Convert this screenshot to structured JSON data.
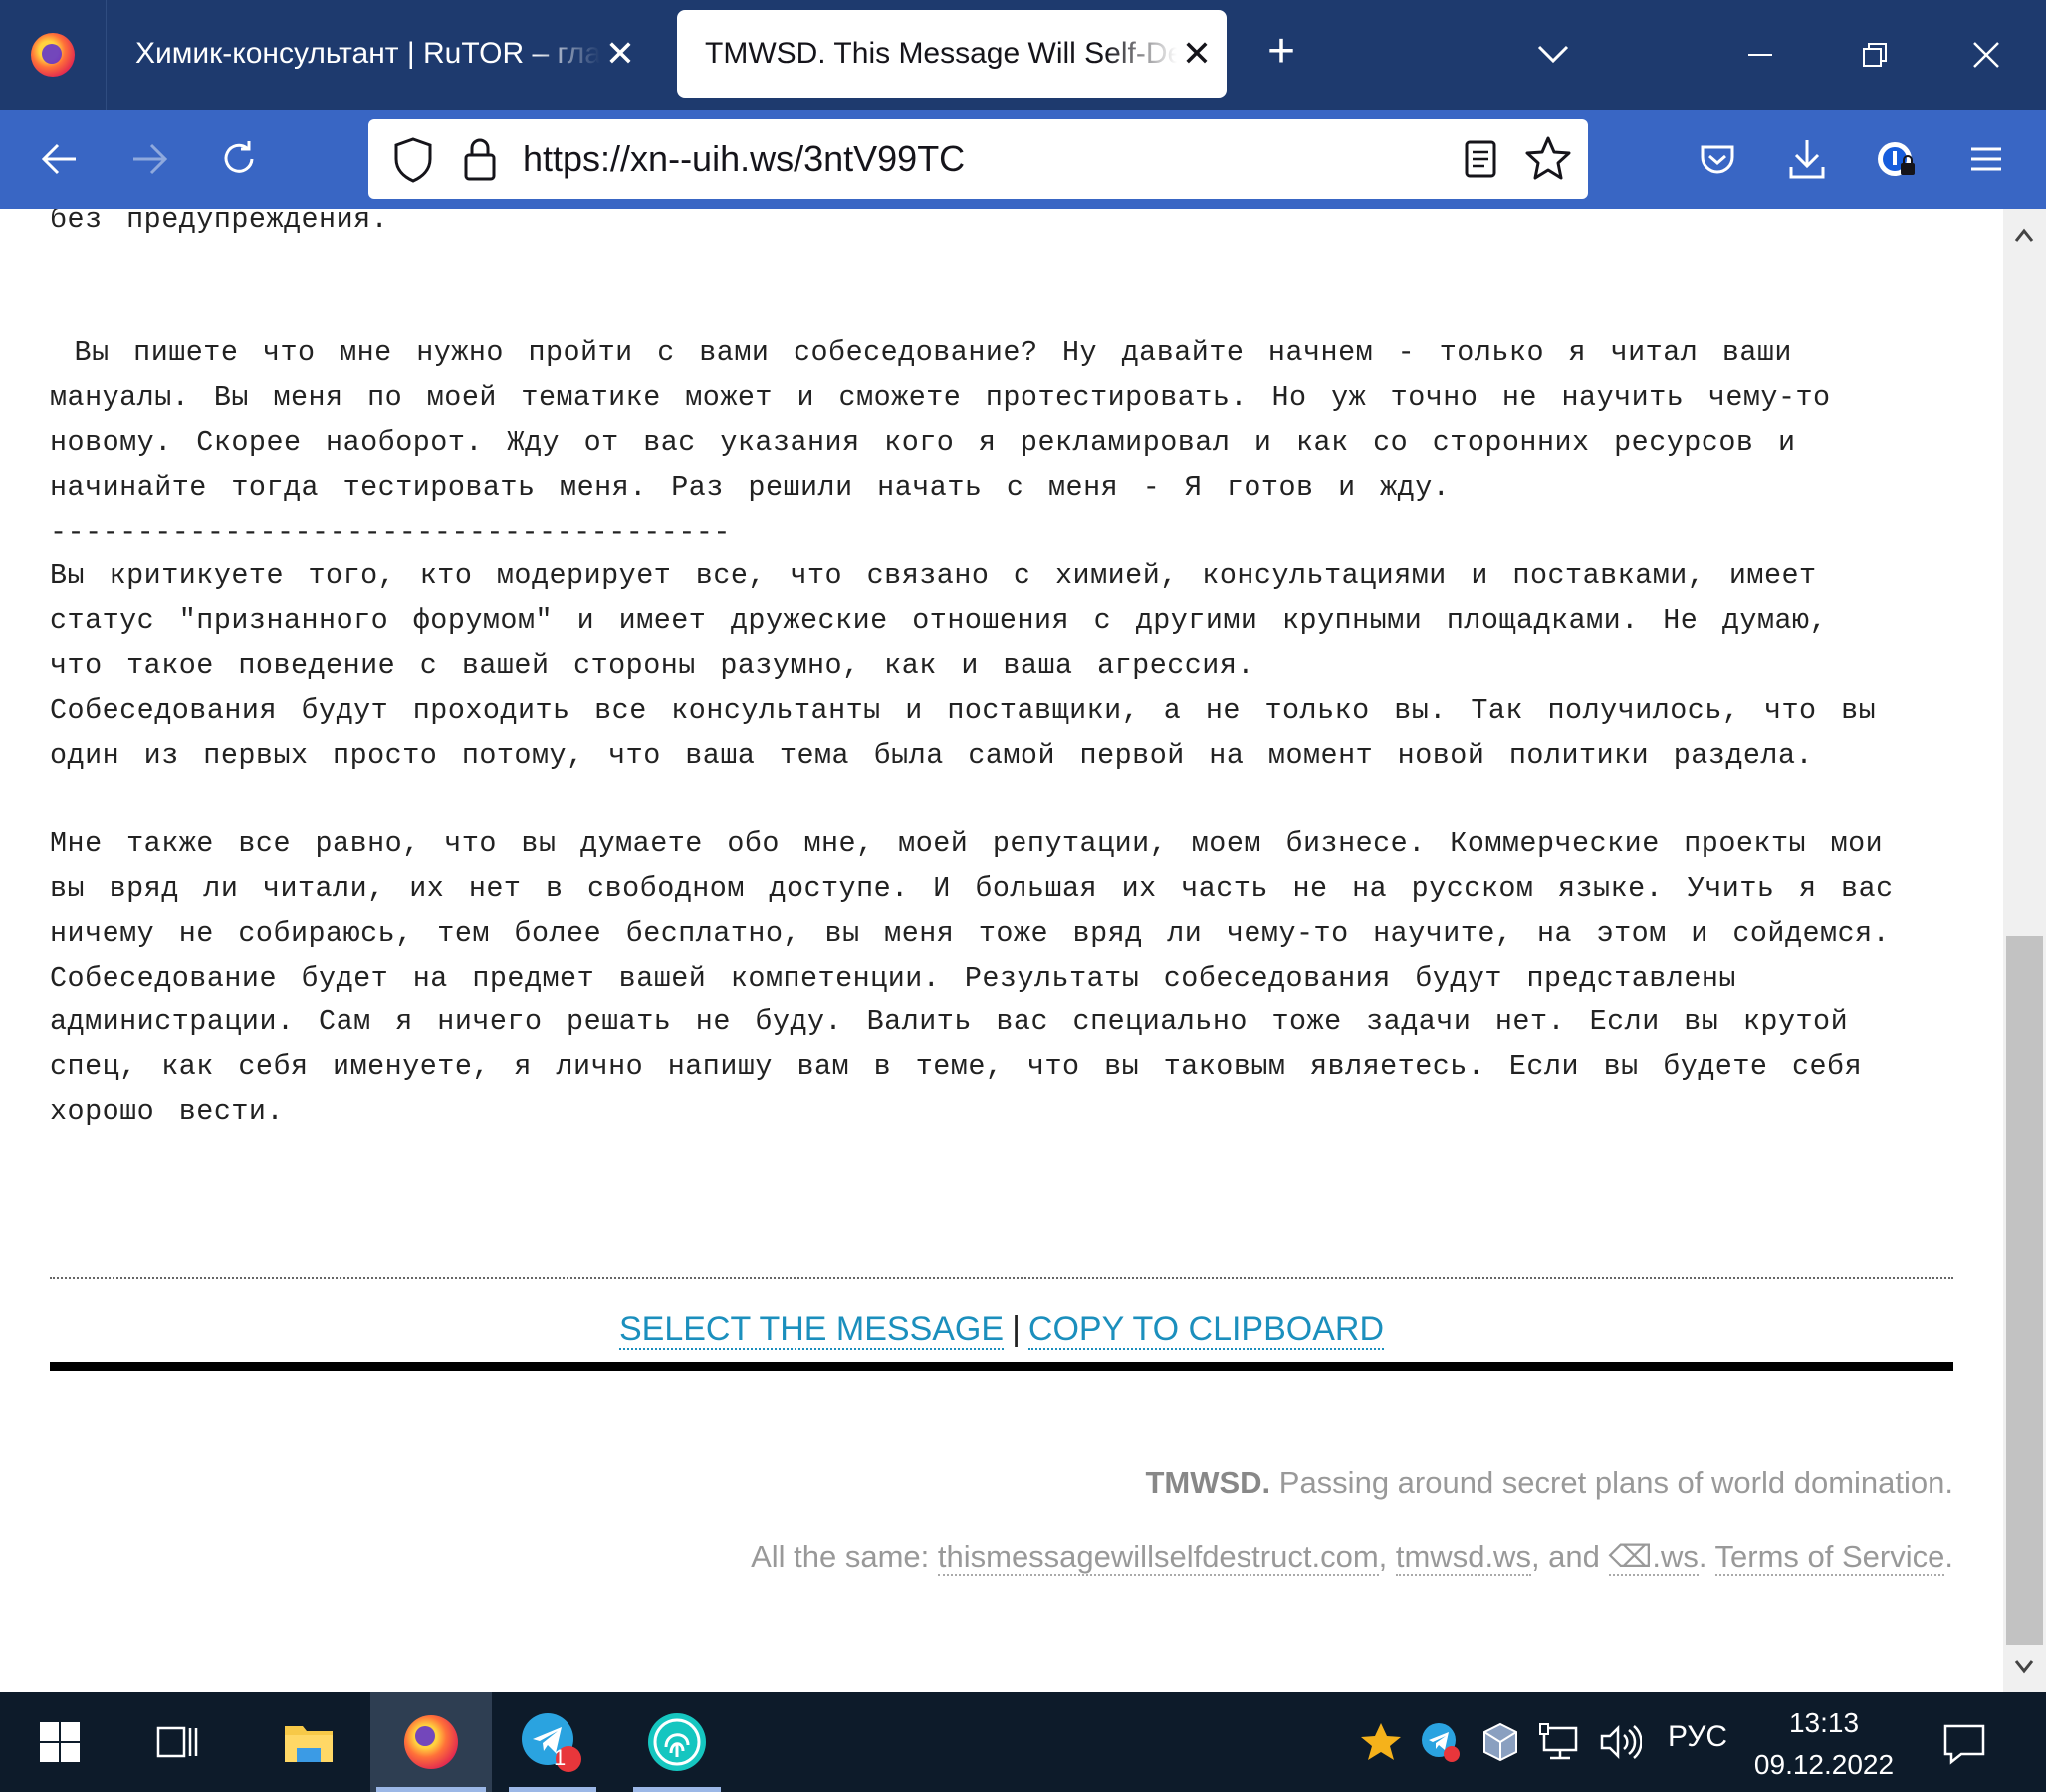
{
  "browser": {
    "tabs": [
      {
        "title": "Химик-консультант | RuTOR – главн",
        "active": false
      },
      {
        "title": "TMWSD. This Message Will Self-Destruct",
        "active": true
      }
    ],
    "new_tab_label": "+",
    "url": "https://xn--uih.ws/3ntV99TC"
  },
  "message": {
    "text": "без предупреждения.\n\n\n Вы пишете что мне нужно пройти с вами собеседование? Ну давайте начнем - только я читал ваши\nмануалы. Вы меня по моей тематике может и сможете протестировать. Но уж точно не научить чему-то\nновому. Скорее наоборот. Жду от вас указания кого я рекламировал и как со сторонних ресурсов и\nначинайте тогда тестировать меня. Раз решили начать с меня - Я готов и жду.\n---------------------------------------\nВы критикуете того, кто модерирует все, что связано с химией, консультациями и поставками, имеет\nстатус \"признанного форумом\" и имеет дружеские отношения с другими крупными площадками. Не думаю,\nчто такое поведение с вашей стороны разумно, как и ваша агрессия.\nСобеседования будут проходить все консультанты и поставщики, а не только вы. Так получилось, что вы\nодин из первых просто потому, что ваша тема была самой первой на момент новой политики раздела.\n\nМне также все равно, что вы думаете обо мне, моей репутации, моем бизнесе. Коммерческие проекты мои\nвы вряд ли читали, их нет в свободном доступе. И большая их часть не на русском языке. Учить я вас\nничему не собираюсь, тем более бесплатно, вы меня тоже вряд ли чему-то научите, на этом и сойдемся.\nСобеседование будет на предмет вашей компетенции. Результаты собеседования будут представлены\nадминистрации. Сам я ничего решать не буду. Валить вас специально тоже задачи нет. Если вы крутой\nспец, как себя именуете, я лично напишу вам в теме, что вы таковым являетесь. Если вы будете себя\nхорошо вести."
  },
  "actions": {
    "select_label": "SELECT THE MESSAGE",
    "separator": "|",
    "copy_label": "COPY TO CLIPBOARD"
  },
  "footer": {
    "brand": "TMWSD.",
    "tagline": " Passing around secret plans of world domination.",
    "mirrors_prefix": "All the same: ",
    "mirror1": "thismessagewillselfdestruct.com",
    "comma1": ", ",
    "mirror2": "tmwsd.ws",
    "and_text": ", and ",
    "mirror3": "⌫.ws",
    "period1": ". ",
    "tos": "Terms of Service",
    "period2": "."
  },
  "taskbar": {
    "telegram_badge": "1",
    "language": "РУС",
    "time": "13:13",
    "date": "09.12.2022"
  },
  "colors": {
    "titlebar": "#1e3a6e",
    "navbar": "#3966c4",
    "link": "#1b8fbd",
    "taskbar": "#0d1b2a"
  }
}
